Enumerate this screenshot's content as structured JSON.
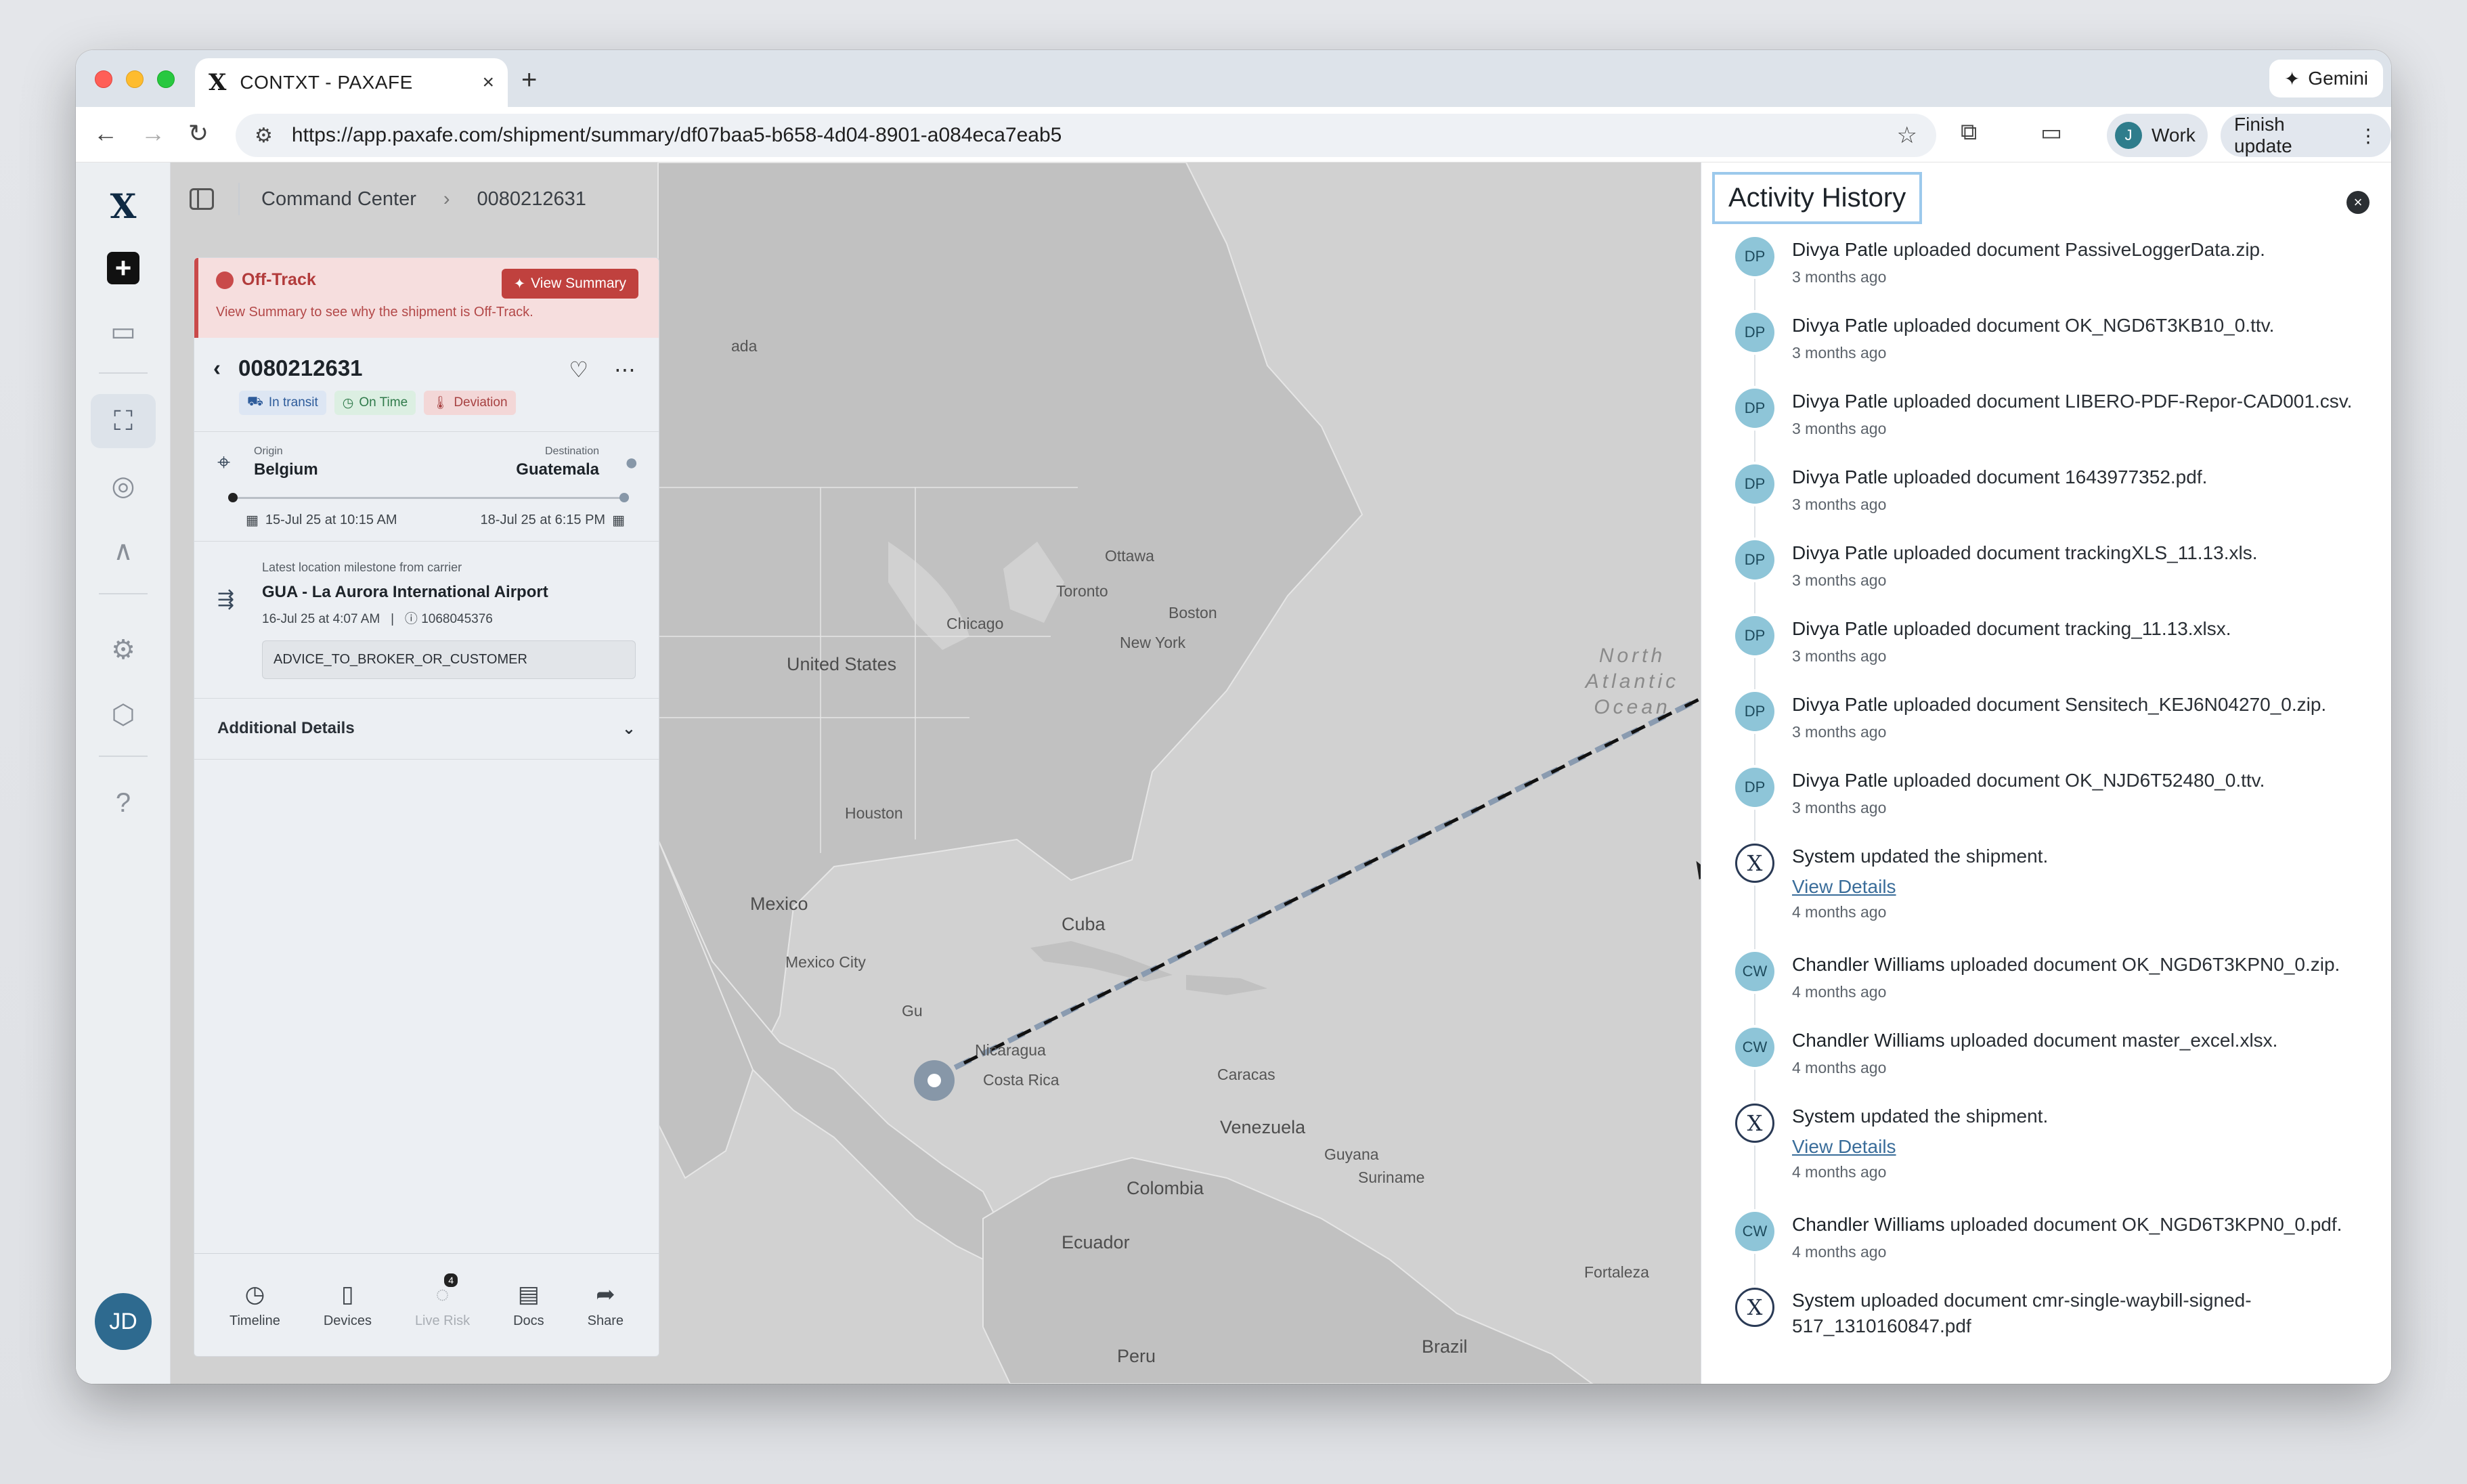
{
  "browser": {
    "tab_title": "CONTXT - PAXAFE",
    "url": "https://app.paxafe.com/shipment/summary/df07baa5-b658-4d04-8901-a084eca7eab5",
    "gemini_label": "Gemini",
    "profile_initial": "J",
    "profile_label": "Work",
    "finish_update_label": "Finish update"
  },
  "rail": {
    "user_initials": "JD"
  },
  "breadcrumb": {
    "root": "Command Center",
    "current": "0080212631"
  },
  "shipment": {
    "alert_title": "Off-Track",
    "alert_button": "View Summary",
    "alert_text": "View Summary to see why the shipment is Off-Track.",
    "id": "0080212631",
    "badges": [
      "In transit",
      "On Time",
      "Deviation"
    ],
    "origin_label": "Origin",
    "origin": "Belgium",
    "destination_label": "Destination",
    "destination": "Guatemala",
    "departure": "15-Jul 25 at 10:15 AM",
    "arrival": "18-Jul 25 at 6:15 PM",
    "milestone_label": "Latest location milestone from carrier",
    "milestone_place": "GUA - La Aurora International Airport",
    "milestone_time": "16-Jul 25 at 4:07 AM",
    "milestone_ref": "1068045376",
    "milestone_code": "ADVICE_TO_BROKER_OR_CUSTOMER",
    "additional_details": "Additional Details",
    "nav": [
      {
        "label": "Timeline",
        "icon": "clock-icon"
      },
      {
        "label": "Devices",
        "icon": "device-icon"
      },
      {
        "label": "Live Risk",
        "icon": "live-risk-icon",
        "badge": "4"
      },
      {
        "label": "Docs",
        "icon": "document-icon"
      },
      {
        "label": "Share",
        "icon": "share-icon"
      }
    ]
  },
  "map": {
    "labels": {
      "canada": "ada",
      "ottawa": "Ottawa",
      "toronto": "Toronto",
      "boston": "Boston",
      "chicago": "Chicago",
      "new_york": "New York",
      "united_states": "United States",
      "houston": "Houston",
      "mexico": "Mexico",
      "mexico_city": "Mexico City",
      "cuba": "Cuba",
      "guatemala_short": "Gu",
      "nicaragua": "Nicaragua",
      "costa_rica": "Costa Rica",
      "caracas": "Caracas",
      "venezuela": "Venezuela",
      "guyana": "Guyana",
      "suriname": "Suriname",
      "colombia": "Colombia",
      "ecuador": "Ecuador",
      "peru": "Peru",
      "brazil": "Brazil",
      "fortaleza": "Fortaleza",
      "ocean": "North Atlantic Ocean"
    }
  },
  "activity": {
    "title": "Activity History",
    "items": [
      {
        "initials": "DP",
        "actor": "Divya Patle",
        "action": "uploaded document",
        "object": "PassiveLoggerData.zip.",
        "time": "3 months ago"
      },
      {
        "initials": "DP",
        "actor": "Divya Patle",
        "action": "uploaded document",
        "object": "OK_NGD6T3KB10_0.ttv.",
        "time": "3 months ago"
      },
      {
        "initials": "DP",
        "actor": "Divya Patle",
        "action": "uploaded document",
        "object": "LIBERO-PDF-Repor-CAD001.csv.",
        "time": "3 months ago"
      },
      {
        "initials": "DP",
        "actor": "Divya Patle",
        "action": "uploaded document",
        "object": "1643977352.pdf.",
        "time": "3 months ago"
      },
      {
        "initials": "DP",
        "actor": "Divya Patle",
        "action": "uploaded document",
        "object": "trackingXLS_11.13.xls.",
        "time": "3 months ago"
      },
      {
        "initials": "DP",
        "actor": "Divya Patle",
        "action": "uploaded document",
        "object": "tracking_11.13.xlsx.",
        "time": "3 months ago"
      },
      {
        "initials": "DP",
        "actor": "Divya Patle",
        "action": "uploaded document",
        "object": "Sensitech_KEJ6N04270_0.zip.",
        "time": "3 months ago"
      },
      {
        "initials": "DP",
        "actor": "Divya Patle",
        "action": "uploaded document",
        "object": "OK_NJD6T52480_0.ttv.",
        "time": "3 months ago"
      },
      {
        "initials": "X",
        "actor": "System",
        "action": "updated the shipment.",
        "object": "",
        "link": "View Details",
        "time": "4 months ago"
      },
      {
        "initials": "CW",
        "actor": "Chandler Williams",
        "action": "uploaded document",
        "object": "OK_NGD6T3KPN0_0.zip.",
        "time": "4 months ago"
      },
      {
        "initials": "CW",
        "actor": "Chandler Williams",
        "action": "uploaded document",
        "object": "master_excel.xlsx.",
        "time": "4 months ago"
      },
      {
        "initials": "X",
        "actor": "System",
        "action": "updated the shipment.",
        "object": "",
        "link": "View Details",
        "time": "4 months ago"
      },
      {
        "initials": "CW",
        "actor": "Chandler Williams",
        "action": "uploaded document",
        "object": "OK_NGD6T3KPN0_0.pdf.",
        "time": "4 months ago"
      },
      {
        "initials": "X",
        "actor": "System",
        "action": "uploaded document",
        "object": "cmr-single-waybill-signed-517_1310160847.pdf",
        "time": ""
      }
    ]
  }
}
